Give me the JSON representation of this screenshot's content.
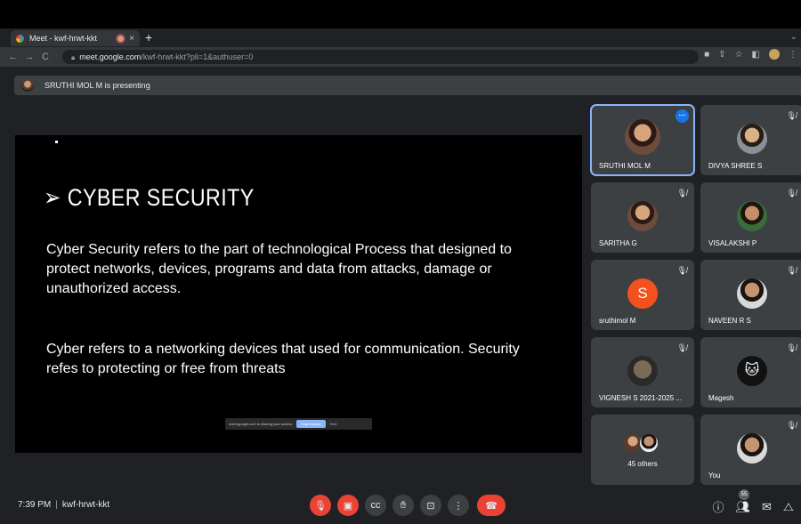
{
  "browser": {
    "tab_title": "Meet - kwf-hrwt-kkt",
    "tab_close": "×",
    "new_tab": "+",
    "url_host": "meet.google.com",
    "url_path": "/kwf-hrwt-kkt?pli=1&authuser=0",
    "nav_back": "←",
    "nav_forward": "→",
    "nav_reload": "C"
  },
  "banner": {
    "text": "SRUTHI MOL M is presenting"
  },
  "slide": {
    "title": "➢ CYBER SECURITY",
    "para1": "Cyber Security refers to the part of technological Process that designed to protect networks, devices, programs and data from attacks, damage or unauthorized access.",
    "para2": "Cyber refers to a networking devices that used for communication. Security refes to protecting or free from threats",
    "share_text": "meet.google.com is sharing your screen.",
    "share_stop": "Stop sharing",
    "share_hide": "Hide"
  },
  "participants": [
    {
      "name": "SRUTHI MOL M"
    },
    {
      "name": "DIVYA SHREE S"
    },
    {
      "name": "SARITHA G"
    },
    {
      "name": "VISALAKSHI P"
    },
    {
      "name": "sruthimol M",
      "initial": "S"
    },
    {
      "name": "NAVEEN R S"
    },
    {
      "name": "VIGNESH S 2021-2025 ..."
    },
    {
      "name": "Magesh"
    },
    {
      "name": "45 others"
    },
    {
      "name": "You"
    }
  ],
  "footer": {
    "time": "7:39 PM",
    "meeting_code": "kwf-hrwt-kkt",
    "people_count": "55"
  },
  "colors": {
    "accent": "#8ab4f8",
    "hangup": "#ea4335",
    "letter_avatar": "#f4511e",
    "tile_bg": "#3c4043"
  },
  "icons": [
    "mic-off-icon",
    "camera-off-icon",
    "captions-icon",
    "raise-hand-icon",
    "present-icon",
    "more-options-icon",
    "hang-up-icon",
    "info-icon",
    "people-icon",
    "chat-icon",
    "activities-icon"
  ]
}
